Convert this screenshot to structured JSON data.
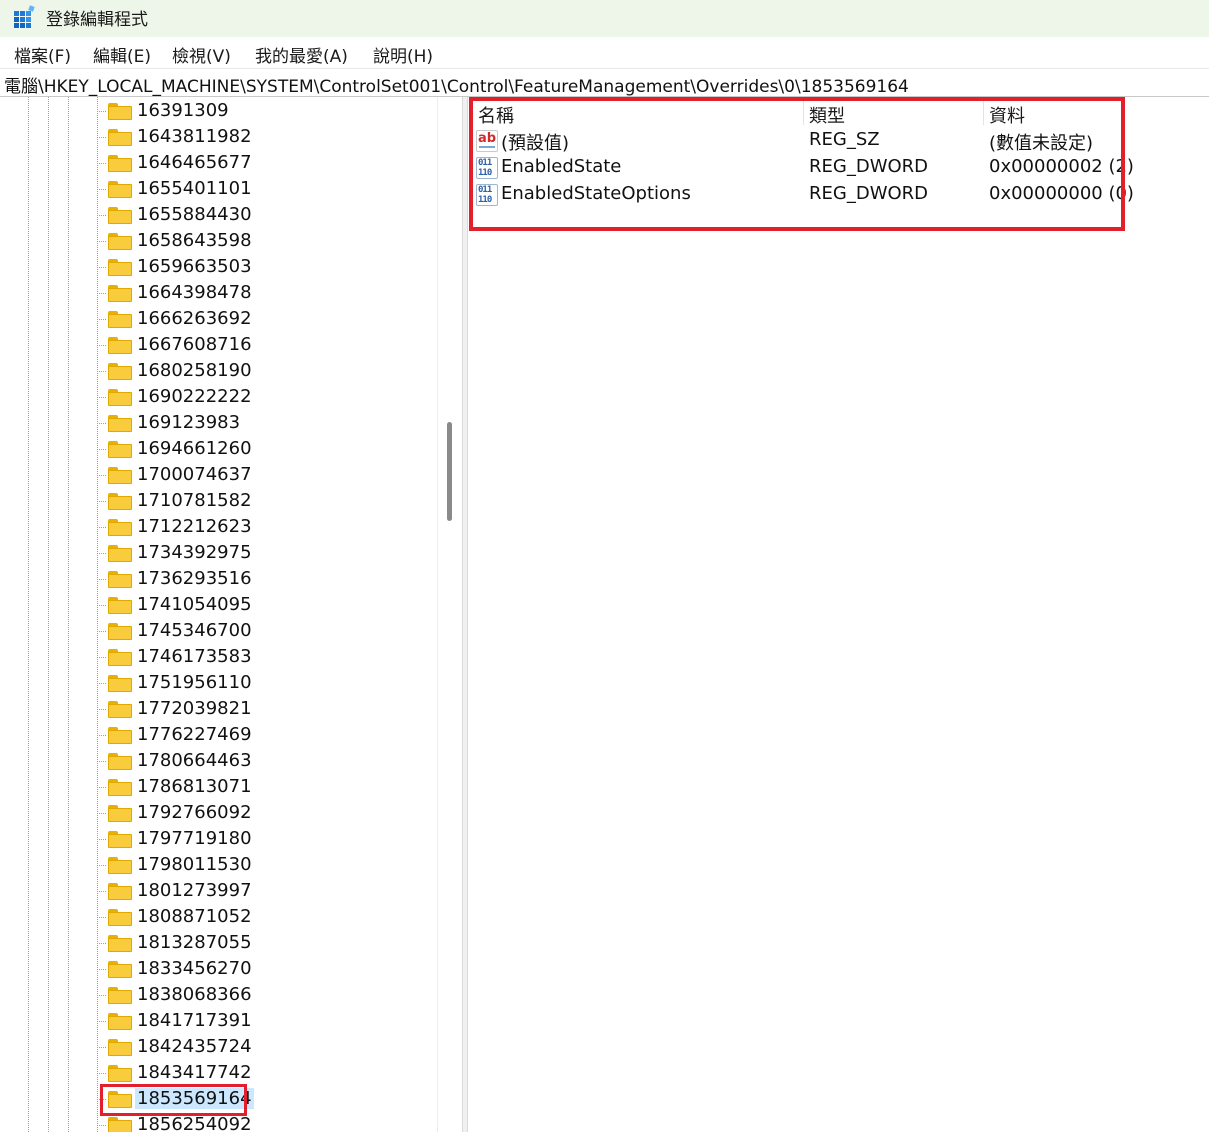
{
  "window": {
    "title": "登錄編輯程式"
  },
  "menu": {
    "items": [
      "檔案(F)",
      "編輯(E)",
      "檢視(V)",
      "我的最愛(A)",
      "說明(H)"
    ]
  },
  "address": {
    "path": "電腦\\HKEY_LOCAL_MACHINE\\SYSTEM\\ControlSet001\\Control\\FeatureManagement\\Overrides\\0\\1853569164"
  },
  "tree": {
    "items": [
      "16391309",
      "1643811982",
      "1646465677",
      "1655401101",
      "1655884430",
      "1658643598",
      "1659663503",
      "1664398478",
      "1666263692",
      "1667608716",
      "1680258190",
      "1690222222",
      "169123983",
      "1694661260",
      "1700074637",
      "1710781582",
      "1712212623",
      "1734392975",
      "1736293516",
      "1741054095",
      "1745346700",
      "1746173583",
      "1751956110",
      "1772039821",
      "1776227469",
      "1780664463",
      "1786813071",
      "1792766092",
      "1797719180",
      "1798011530",
      "1801273997",
      "1808871052",
      "1813287055",
      "1833456270",
      "1838068366",
      "1841717391",
      "1842435724",
      "1843417742",
      "1853569164",
      "1856254092"
    ],
    "selected": "1853569164"
  },
  "values": {
    "headers": {
      "name": "名稱",
      "type": "類型",
      "data": "資料"
    },
    "rows": [
      {
        "icon": "string-value-icon",
        "name": "(預設值)",
        "type": "REG_SZ",
        "data": "(數值未設定)"
      },
      {
        "icon": "binary-value-icon",
        "name": "EnabledState",
        "type": "REG_DWORD",
        "data": "0x00000002 (2)"
      },
      {
        "icon": "binary-value-icon",
        "name": "EnabledStateOptions",
        "type": "REG_DWORD",
        "data": "0x00000000 (0)"
      }
    ]
  },
  "colors": {
    "highlight": "#e21f2c",
    "titlebar": "#eef6e9",
    "selection": "#cce8ff",
    "folder": "#f8cc3d"
  }
}
